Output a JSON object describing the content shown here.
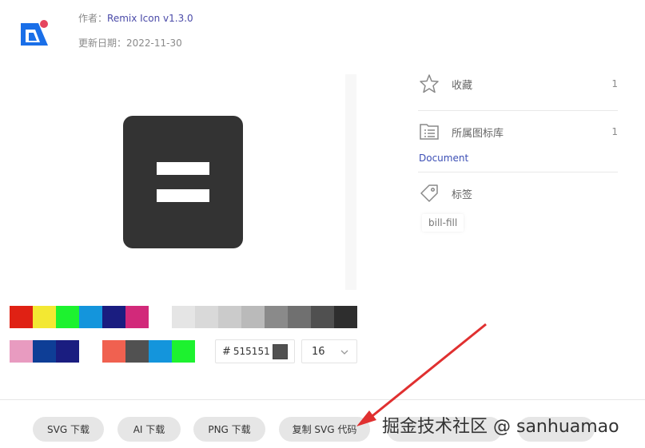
{
  "meta": {
    "author_label": "作者：",
    "author_value": "Remix Icon v1.3.0",
    "updated_label": "更新日期：",
    "updated_value": "2022-11-30"
  },
  "palette": {
    "row1": [
      "#e02114",
      "#f3e832",
      "#1df22f",
      "#1495dc",
      "#1a1d80",
      "#d2297a",
      "#ffffff",
      "#e5e5e5",
      "#d9d9d9",
      "#cbcbcb",
      "#bababa",
      "#8a8a8a",
      "#707070",
      "#505050",
      "#2e2e2e"
    ],
    "row2": [
      "#e89bc0",
      "#0e3e96",
      "#1a1d80",
      "#ffffff",
      "#f06150",
      "#515151",
      "#1495dc",
      "#1df22f"
    ]
  },
  "color_input": {
    "hash": "#",
    "value": "515151",
    "chip_color": "#515151"
  },
  "size_select": {
    "value": "16"
  },
  "sidebar": {
    "favorite": {
      "label": "收藏",
      "count": "1"
    },
    "library": {
      "label": "所属图标库",
      "count": "1",
      "link": "Document"
    },
    "tags": {
      "label": "标签",
      "items": [
        "bill-fill"
      ]
    }
  },
  "buttons": {
    "svg_download": "SVG 下载",
    "ai_download": "AI 下载",
    "png_download": "PNG 下载",
    "copy_svg": "复制 SVG 代码"
  },
  "watermark": "掘金技术社区 @ sanhuamao",
  "colors": {
    "icon_fill": "#333333",
    "accent": "#3c4fb5",
    "arrow": "#e03030"
  }
}
